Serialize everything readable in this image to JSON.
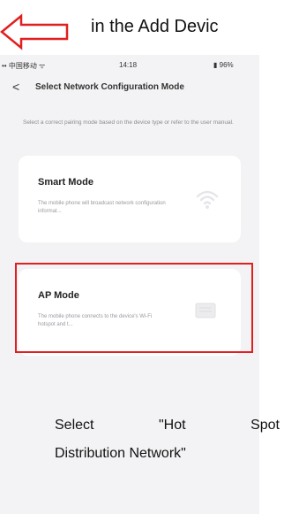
{
  "top_caption": "in the Add Devic",
  "status_bar": {
    "left": "•• 中国移动 ᯤ",
    "time": "14:18",
    "battery": "▮ 96%"
  },
  "nav": {
    "back_glyph": "<",
    "title": "Select Network Configuration Mode"
  },
  "subtitle": "Select a correct pairing mode based on the device type or refer to the user manual.",
  "cards": [
    {
      "title": "Smart Mode",
      "desc": "The mobile phone will broadcast network configuration informat...",
      "icon": "wifi-icon"
    },
    {
      "title": "AP Mode",
      "desc": "The mobile phone connects to the device's Wi-Fi hotspot and t...",
      "icon": "hotspot-icon"
    }
  ],
  "bottom_caption": {
    "w1": "Select",
    "w2": "\"Hot",
    "w3": "Spot",
    "line2": "Distribution Network\""
  },
  "colors": {
    "arrow": "#e02020",
    "highlight": "#e02020"
  }
}
